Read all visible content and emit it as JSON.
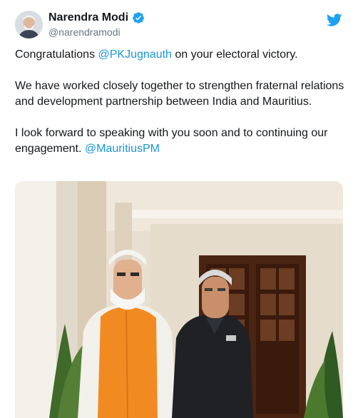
{
  "author": {
    "name": "Narendra Modi",
    "handle": "@narendramodi",
    "verified": true
  },
  "icons": {
    "avatar": "profile-photo",
    "verified": "verified-badge-icon",
    "brand": "twitter-bird-icon"
  },
  "colors": {
    "link": "#1b95e0",
    "verified": "#1da1f2",
    "brand": "#1da1f2",
    "handle": "#657786"
  },
  "tweet": {
    "p1_text1": "Congratulations ",
    "p1_mention": "@PKJugnauth",
    "p1_text2": " on your electoral victory.",
    "p2": "We have worked closely together to strengthen fraternal relations and development partnership between India and Mauritius.",
    "p3_text": "I look forward to speaking with you soon and to continuing our engagement. ",
    "p3_mention": "@MauritiusPM"
  },
  "media": {
    "type": "photo"
  }
}
